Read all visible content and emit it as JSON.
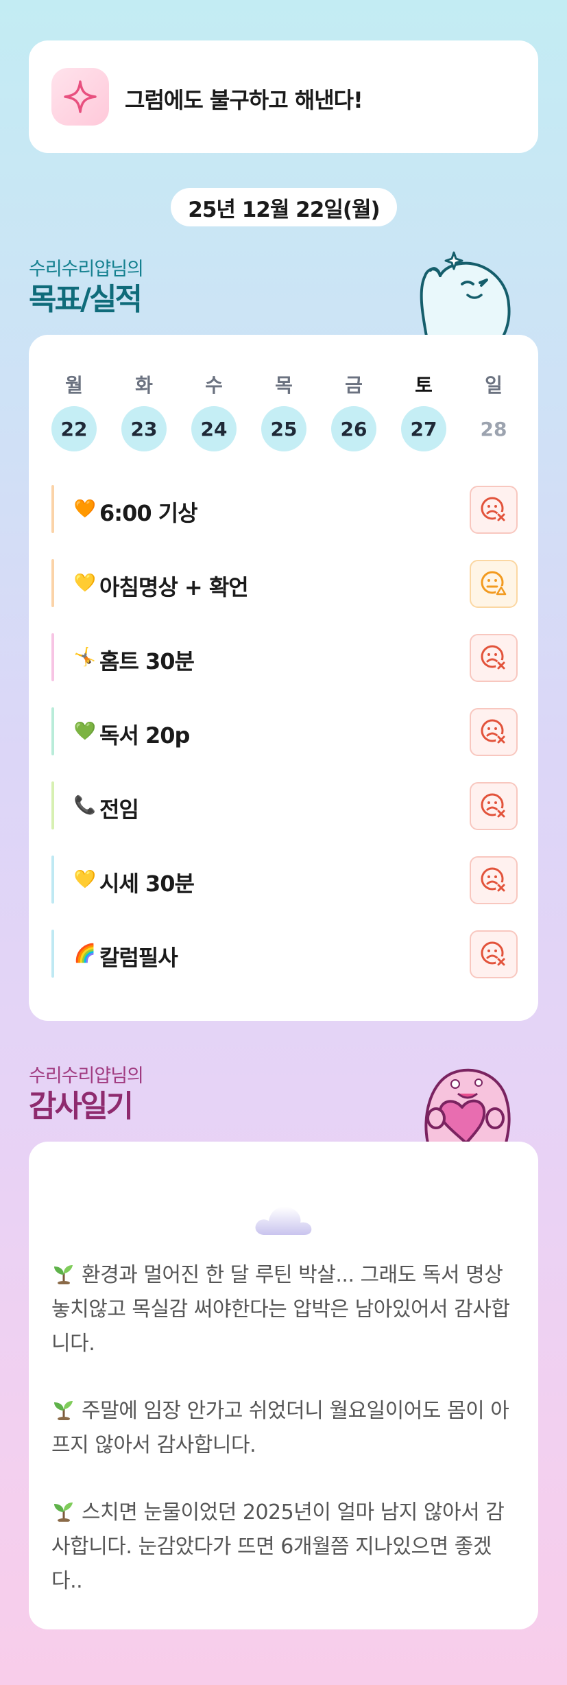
{
  "motto": {
    "text": "그럼에도 불구하고 해낸다!",
    "icon": "sparkle-icon"
  },
  "date_label": "25년 12월 22일(월)",
  "goals_section": {
    "subtitle": "수리수리얍님의",
    "title": "목표/실적"
  },
  "week": [
    {
      "day": "월",
      "date": "22"
    },
    {
      "day": "화",
      "date": "23"
    },
    {
      "day": "수",
      "date": "24"
    },
    {
      "day": "목",
      "date": "25"
    },
    {
      "day": "금",
      "date": "26"
    },
    {
      "day": "토",
      "date": "27"
    },
    {
      "day": "일",
      "date": "28"
    }
  ],
  "goals": [
    {
      "emoji": "🧡",
      "label": "6:00 기상",
      "status": "fail"
    },
    {
      "emoji": "💛",
      "label": "아침명상 + 확언",
      "status": "warn"
    },
    {
      "emoji": "🤸",
      "label": "홈트 30분",
      "status": "fail"
    },
    {
      "emoji": "💚",
      "label": "독서 20p",
      "status": "fail"
    },
    {
      "emoji": "📞",
      "label": "전임",
      "status": "fail"
    },
    {
      "emoji": "💛",
      "label": "시세 30분",
      "status": "fail"
    },
    {
      "emoji": "🌈",
      "label": "칼럼필사",
      "status": "fail"
    }
  ],
  "gratitude_section": {
    "subtitle": "수리수리얍님의",
    "title": "감사일기"
  },
  "gratitude_entries": [
    "환경과 멀어진 한 달 루틴 박살... 그래도 독서 명상 놓치않고 목실감 써야한다는 압박은 남아있어서 감사합니다.",
    "주말에 임장 안가고 쉬었더니 월요일이어도 몸이 아프지 않아서 감사합니다.",
    "스치면 눈물이었던 2025년이 얼마 남지 않아서 감사합니다. 눈감았다가 뜨면 6개월쯤 지나있으면 좋겠다.."
  ],
  "colors": {
    "goal_title": "#0f6b7a",
    "gratitude_title": "#8e2a6e",
    "fail": "#e2533b",
    "warn": "#f29a1f"
  }
}
